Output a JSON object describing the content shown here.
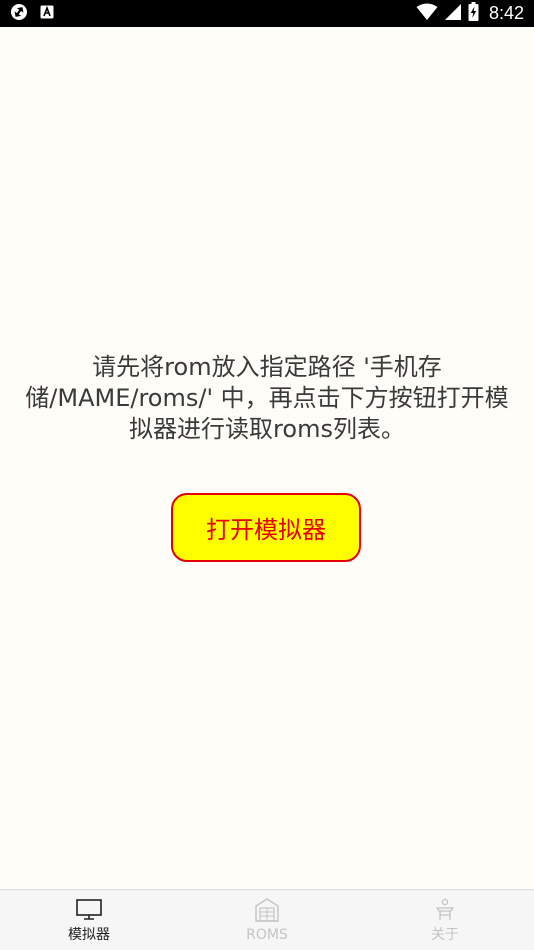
{
  "status_bar": {
    "time": "8:42",
    "icons": [
      "sync-icon",
      "app-a-icon",
      "wifi-icon",
      "signal-icon",
      "battery-charging-icon"
    ]
  },
  "main": {
    "instruction_text": "请先将rom放入指定路径 '手机存储/MAME/roms/' 中，再点击下方按钮打开模拟器进行读取roms列表。",
    "open_button_label": "打开模拟器"
  },
  "bottom_nav": {
    "items": [
      {
        "label": "模拟器",
        "icon": "monitor-icon",
        "active": true
      },
      {
        "label": "ROMS",
        "icon": "storage-icon",
        "active": false
      },
      {
        "label": "关于",
        "icon": "about-icon",
        "active": false
      }
    ]
  },
  "colors": {
    "background": "#fffdf7",
    "button_fill": "#ffff00",
    "button_accent": "#e60000",
    "nav_active": "#222222",
    "nav_inactive": "#c4c4c4"
  }
}
